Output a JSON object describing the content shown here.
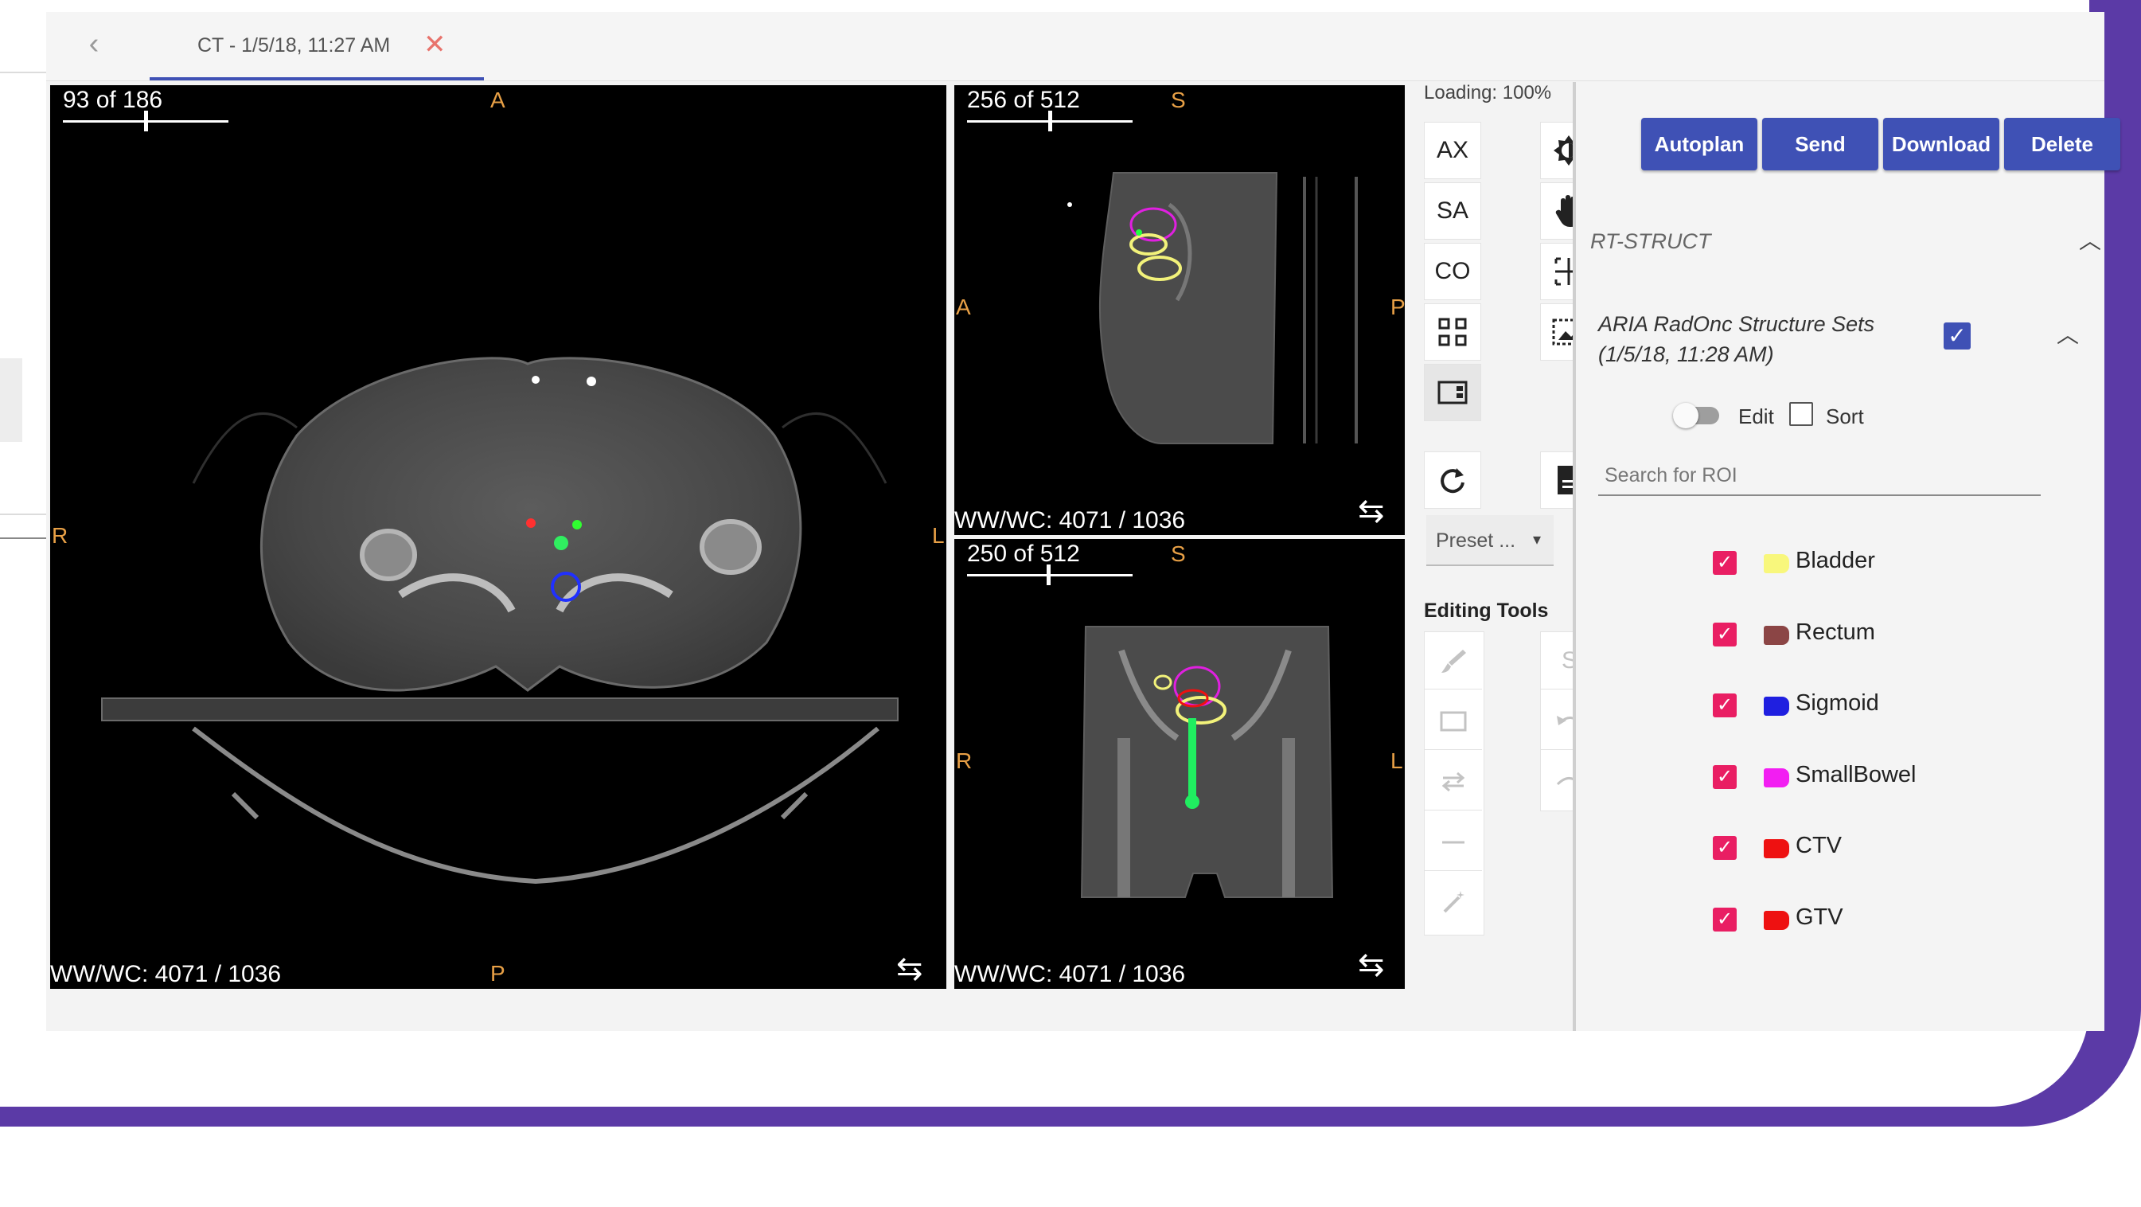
{
  "tab": {
    "back": "‹",
    "label": "CT - 1/5/18, 11:27 AM",
    "close": "✕"
  },
  "viewports": {
    "axial": {
      "slice": "93 of 186",
      "slice_fraction": 0.5,
      "window": "WW/WC: 4071 / 1036",
      "top": "A",
      "bottom": "P",
      "left": "R",
      "right": "L"
    },
    "sagittal": {
      "slice": "256 of 512",
      "slice_fraction": 0.5,
      "window": "WW/WC: 4071 / 1036",
      "top": "S",
      "left": "A",
      "right": "P"
    },
    "coronal": {
      "slice": "250 of 512",
      "slice_fraction": 0.49,
      "window": "WW/WC: 4071 / 1036",
      "top": "S",
      "left": "R",
      "right": "L"
    },
    "cycle_icon": "⇆"
  },
  "toolbar": {
    "loading": "Loading: 100%",
    "views": {
      "ax": "AX",
      "sa": "SA",
      "co": "CO"
    },
    "icons": [
      "contrast-icon",
      "hand-pan-icon",
      "crosshair-icon",
      "image-capture-icon",
      "grid-layout-icon",
      "layout-sidebar-icon",
      "reset-icon",
      "document-icon"
    ],
    "preset": {
      "label": "Preset ...",
      "arrow": "▾"
    },
    "editing_title": "Editing Tools",
    "editing_icons": [
      "brush-icon",
      "rectangle-icon",
      "interpolate-icon",
      "line-icon",
      "magic-wand-icon",
      "s-icon",
      "undo-icon",
      "redo-icon"
    ],
    "s_label": "S"
  },
  "actions": {
    "autoplan": "Autoplan",
    "send": "Send",
    "download": "Download",
    "delete": "Delete"
  },
  "rt_struct": {
    "title": "RT-STRUCT",
    "set_name_line1": "ARIA RadOnc Structure Sets",
    "set_name_line2": "(1/5/18, 11:28 AM)",
    "checked": "✓",
    "edit_label": "Edit",
    "sort_label": "Sort",
    "search_placeholder": "Search for ROI",
    "rois": [
      {
        "name": "Bladder",
        "color": "#f8f77c"
      },
      {
        "name": "Rectum",
        "color": "#8b4545"
      },
      {
        "name": "Sigmoid",
        "color": "#1f1fe0"
      },
      {
        "name": "SmallBowel",
        "color": "#f21ef2"
      },
      {
        "name": "CTV",
        "color": "#ee1111"
      },
      {
        "name": "GTV",
        "color": "#ee1111"
      }
    ]
  },
  "colors": {
    "accent": "#3f51b5",
    "frame": "#5b3aa6",
    "roi_check": "#e91e63",
    "orientation": "#e8a046"
  }
}
